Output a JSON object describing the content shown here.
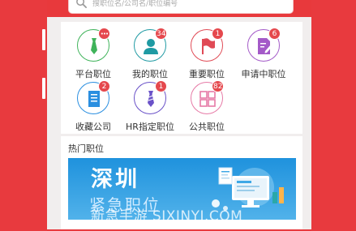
{
  "search": {
    "placeholder": "搜职位名/公司名/职位编号",
    "icon": "search-icon"
  },
  "grid": [
    {
      "label": "平台职位",
      "badge": "•••",
      "icon": "tie-icon",
      "color": "#3fb35a"
    },
    {
      "label": "我的职位",
      "badge": "34",
      "icon": "person-icon",
      "color": "#1f9aa3"
    },
    {
      "label": "重要职位",
      "badge": "1",
      "icon": "flag-icon",
      "color": "#e04a55"
    },
    {
      "label": "申请中职位",
      "badge": "6",
      "icon": "document-edit-icon",
      "color": "#a45ac8"
    },
    {
      "label": "收藏公司",
      "badge": "2",
      "icon": "building-icon",
      "color": "#2b8fe0"
    },
    {
      "label": "HR指定职位",
      "badge": "1",
      "icon": "tie-icon",
      "color": "#6a52c8"
    },
    {
      "label": "公共职位",
      "badge": "82",
      "icon": "grid-icon",
      "color": "#e67aa6"
    }
  ],
  "hot": {
    "title": "热门职位",
    "banner_main": "深圳",
    "banner_sub": "紧急职位"
  },
  "watermark": "新急手游 SJXINYI.COM",
  "colors": {
    "accent": "#e83a3e",
    "badge": "#e5484d"
  }
}
